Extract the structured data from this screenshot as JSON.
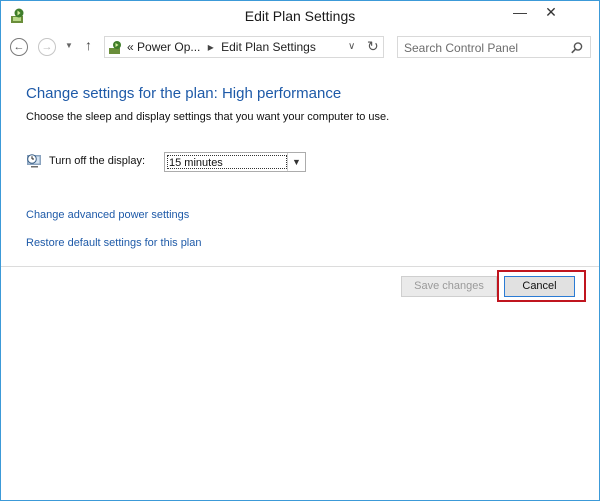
{
  "window": {
    "title": "Edit Plan Settings",
    "minimize_glyph": "—",
    "close_glyph": "✕"
  },
  "nav": {
    "breadcrumb": {
      "overflow": "«",
      "items": [
        "Power Op...",
        "Edit Plan Settings"
      ],
      "separator": "▸"
    },
    "search_placeholder": "Search Control Panel"
  },
  "main": {
    "heading": "Change settings for the plan: High performance",
    "subtitle": "Choose the sleep and display settings that you want your computer to use.",
    "display_setting": {
      "label": "Turn off the display:",
      "value": "15 minutes"
    },
    "links": {
      "advanced": "Change advanced power settings",
      "restore": "Restore default settings for this plan"
    }
  },
  "footer": {
    "save_label": "Save changes",
    "cancel_label": "Cancel"
  },
  "colors": {
    "link": "#1e5aa8",
    "highlight": "#c0151f",
    "window_border": "#3c9ad8"
  },
  "icons": [
    "power-plan-icon",
    "back-icon",
    "forward-icon",
    "recent-dropdown-icon",
    "up-icon",
    "control-panel-icon",
    "address-dropdown-icon",
    "refresh-icon",
    "search-icon",
    "display-clock-icon",
    "chevron-down-icon"
  ]
}
